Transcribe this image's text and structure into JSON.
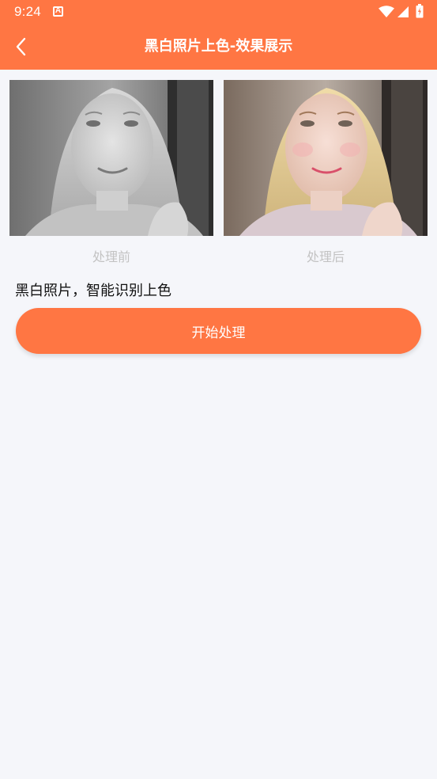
{
  "status_bar": {
    "time": "9:24",
    "notification_icon": "a-icon",
    "icons": [
      "wifi-icon",
      "signal-icon",
      "battery-icon"
    ]
  },
  "header": {
    "title": "黑白照片上色-效果展示",
    "back_icon": "chevron-left-icon"
  },
  "comparison": {
    "before_label": "处理前",
    "after_label": "处理后"
  },
  "description": "黑白照片，智能识别上色",
  "start_button_label": "开始处理",
  "colors": {
    "accent": "#ff7643",
    "background": "#f5f6fa",
    "caption": "#c3c3c3"
  }
}
